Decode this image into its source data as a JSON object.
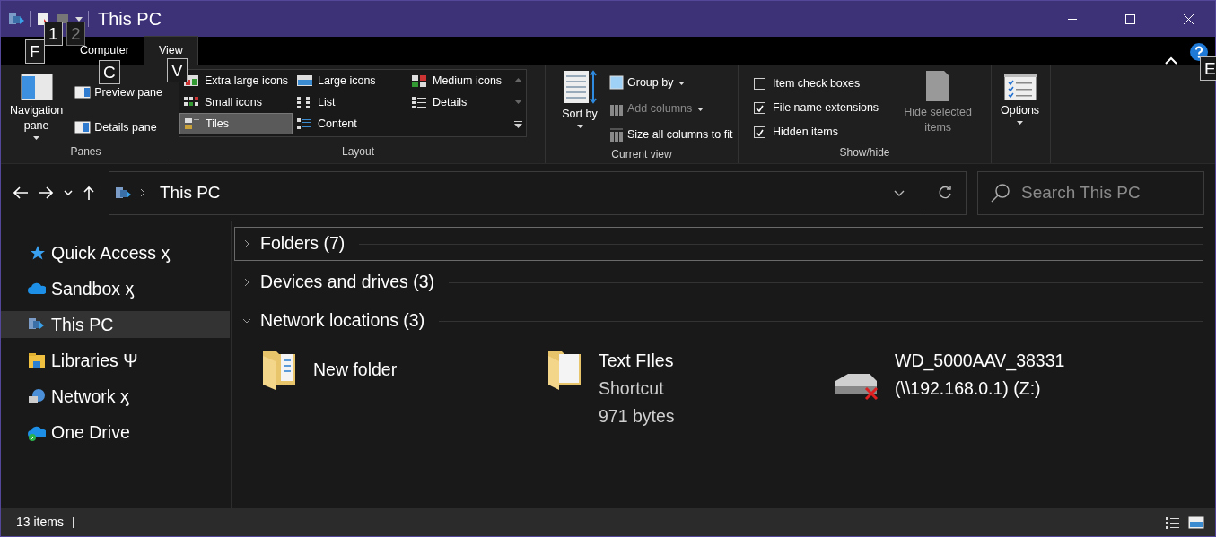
{
  "window": {
    "title": "This PC"
  },
  "key_tips": [
    {
      "label": "F",
      "disabled": false
    },
    {
      "label": "1",
      "disabled": false
    },
    {
      "label": "2",
      "disabled": true
    },
    {
      "label": "C",
      "disabled": false
    },
    {
      "label": "V",
      "disabled": false
    },
    {
      "label": "E",
      "disabled": false
    }
  ],
  "ribbon_tabs": [
    {
      "label": "Computer",
      "selected": false
    },
    {
      "label": "View",
      "selected": true
    }
  ],
  "ribbon": {
    "panes": {
      "label": "Panes",
      "large": {
        "label": "Navigation pane"
      },
      "items": [
        {
          "label": "Preview pane"
        },
        {
          "label": "Details pane"
        }
      ]
    },
    "layout": {
      "label": "Layout",
      "options": [
        {
          "label": "Extra large icons",
          "selected": false
        },
        {
          "label": "Large icons",
          "selected": false
        },
        {
          "label": "Medium icons",
          "selected": false
        },
        {
          "label": "Small icons",
          "selected": false
        },
        {
          "label": "List",
          "selected": false
        },
        {
          "label": "Details",
          "selected": false
        },
        {
          "label": "Tiles",
          "selected": true
        },
        {
          "label": "Content",
          "selected": false
        }
      ]
    },
    "current_view": {
      "label": "Current view",
      "large": {
        "label": "Sort by"
      },
      "items": [
        {
          "label": "Group by",
          "disabled": false,
          "dropdown": true
        },
        {
          "label": "Add columns",
          "disabled": true,
          "dropdown": true
        },
        {
          "label": "Size all columns to fit",
          "disabled": false,
          "dropdown": false
        }
      ]
    },
    "show_hide": {
      "label": "Show/hide",
      "checkboxes": [
        {
          "label": "Item check boxes",
          "checked": false
        },
        {
          "label": "File name extensions",
          "checked": true
        },
        {
          "label": "Hidden items",
          "checked": true
        }
      ],
      "large": {
        "label": "Hide selected items",
        "disabled": true
      }
    },
    "options": {
      "label": "Options"
    }
  },
  "address_bar": {
    "path": "This PC"
  },
  "search": {
    "placeholder": "Search This PC"
  },
  "sidebar": {
    "items": [
      {
        "label": "Quick Access ӽ",
        "kind": "star",
        "selected": false
      },
      {
        "label": "Sandbox ӽ",
        "kind": "cloud",
        "selected": false
      },
      {
        "label": "This PC",
        "kind": "pc",
        "selected": true
      },
      {
        "label": "Libraries Ψ",
        "kind": "library",
        "selected": false
      },
      {
        "label": "Network ӽ",
        "kind": "network",
        "selected": false
      },
      {
        "label": "One Drive",
        "kind": "cloud-ok",
        "selected": false
      }
    ]
  },
  "groups": [
    {
      "label": "Folders (7)",
      "expanded": false,
      "focused": true
    },
    {
      "label": "Devices and drives (3)",
      "expanded": false,
      "focused": false
    },
    {
      "label": "Network locations (3)",
      "expanded": true,
      "focused": false,
      "items": [
        {
          "kind": "folder",
          "lines": [
            "New folder"
          ]
        },
        {
          "kind": "shortcut",
          "lines": [
            "Text FIles",
            "Shortcut",
            "971 bytes"
          ]
        },
        {
          "kind": "drive",
          "lines": [
            "WD_5000AAV_38331",
            "(\\\\192.168.0.1) (Z:)"
          ]
        }
      ]
    }
  ],
  "status_bar": {
    "count": "13 items"
  }
}
